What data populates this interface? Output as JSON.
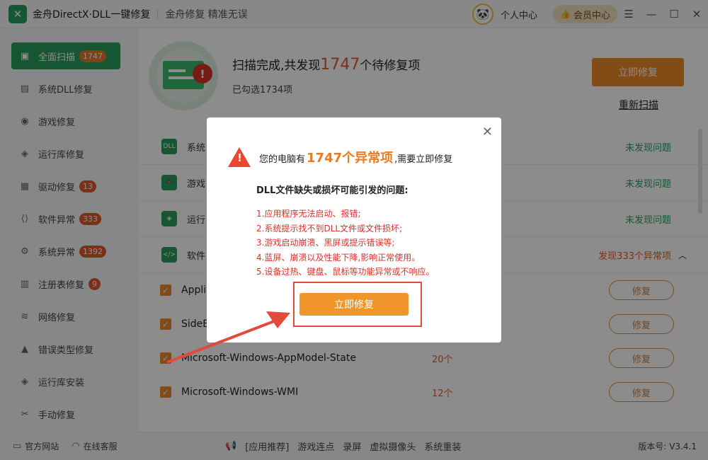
{
  "titlebar": {
    "app_title": "金舟DirectX·DLL一键修复",
    "slogan": "金舟修复 精准无误",
    "personal_center": "个人中心",
    "vip_center": "会员中心"
  },
  "sidebar": {
    "items": [
      {
        "label": "全面扫描",
        "badge": "1747"
      },
      {
        "label": "系统DLL修复",
        "badge": ""
      },
      {
        "label": "游戏修复",
        "badge": ""
      },
      {
        "label": "运行库修复",
        "badge": ""
      },
      {
        "label": "驱动修复",
        "badge": "13"
      },
      {
        "label": "软件异常",
        "badge": "333"
      },
      {
        "label": "系统异常",
        "badge": "1392"
      },
      {
        "label": "注册表修复",
        "badge": "9"
      },
      {
        "label": "网络修复",
        "badge": ""
      },
      {
        "label": "错误类型修复",
        "badge": ""
      },
      {
        "label": "运行库安装",
        "badge": ""
      },
      {
        "label": "手动修复",
        "badge": ""
      }
    ]
  },
  "hero": {
    "text_prefix": "扫描完成,共发现",
    "count": "1747",
    "text_suffix": "个待修复项",
    "selected": "已勾选1734项",
    "fix_now": "立即修复",
    "rescan": "重新扫描"
  },
  "categories": [
    {
      "name": "系统",
      "icon": "DLL",
      "status": "未发现问题"
    },
    {
      "name": "游戏",
      "icon": "🎮",
      "status": "未发现问题"
    },
    {
      "name": "运行",
      "icon": "◈",
      "status": "未发现问题"
    },
    {
      "name": "软件",
      "icon": "</>",
      "status": "发现333个异常项"
    }
  ],
  "items": [
    {
      "name": "Appli",
      "count": "",
      "fix": "修复"
    },
    {
      "name": "SideB",
      "count": "",
      "fix": "修复"
    },
    {
      "name": "Microsoft-Windows-AppModel-State",
      "count": "20个",
      "fix": "修复"
    },
    {
      "name": "Microsoft-Windows-WMI",
      "count": "12个",
      "fix": "修复"
    }
  ],
  "footer": {
    "official_site": "官方网站",
    "online_service": "在线客服",
    "app_recommend": "[应用推荐]",
    "links": [
      "游戏连点",
      "录屏",
      "虚拟摄像头",
      "系统重装"
    ],
    "version": "版本号: V3.4.1"
  },
  "dialog": {
    "head_prefix": "您的电脑有",
    "head_count": "1747个异常项",
    "head_suffix": ",需要立即修复",
    "subtitle": "DLL文件缺失或损坏可能引发的问题:",
    "issues": [
      "1.应用程序无法启动、报错;",
      "2.系统提示找不到DLL文件或文件损坏;",
      "3.游戏启动崩溃、黑屏或提示错误等;",
      "4.蓝屏、崩溃以及性能下降,影响正常使用。",
      "5.设备过热、键盘、鼠标等功能异常或不响应。"
    ],
    "fix_button": "立即修复"
  },
  "colors": {
    "brand_green": "#2a9d5c",
    "accent_orange": "#ee8a28",
    "warn_red": "#d9322b"
  }
}
